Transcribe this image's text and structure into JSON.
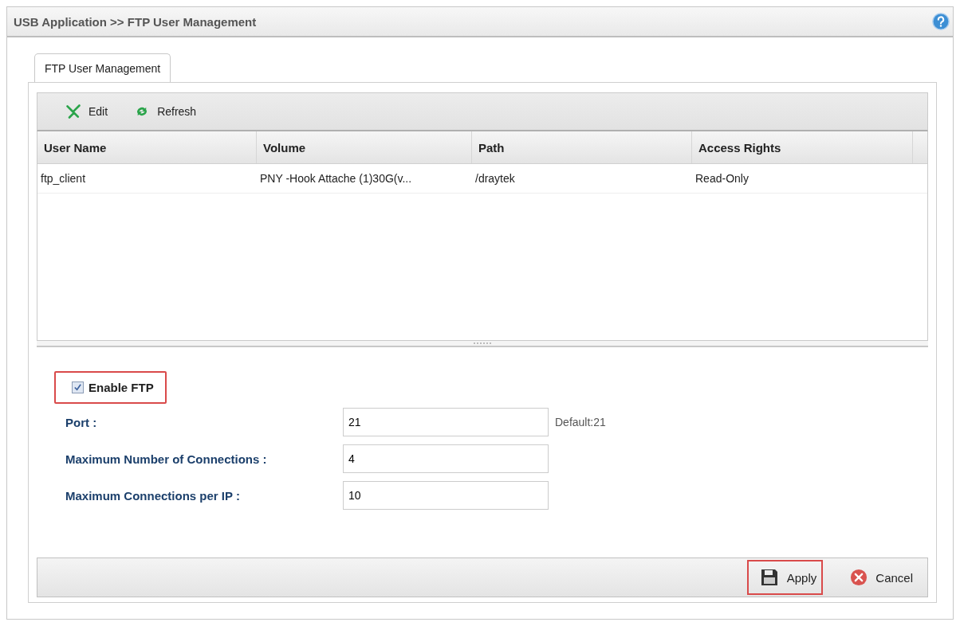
{
  "window": {
    "title": "USB Application >> FTP User Management"
  },
  "tabs": [
    {
      "label": "FTP User Management",
      "selected": true
    }
  ],
  "toolbar": [
    {
      "kind": "edit",
      "label": "Edit"
    },
    {
      "kind": "refresh",
      "label": "Refresh"
    }
  ],
  "table": {
    "columns": [
      "User Name",
      "Volume",
      "Path",
      "Access Rights"
    ],
    "rows": [
      [
        "ftp_client",
        "PNY -Hook Attache (1)30G(v...",
        "/draytek",
        "Read-Only"
      ]
    ]
  },
  "enable_ftp": {
    "label": "Enable FTP",
    "checked": true,
    "highlighted": true
  },
  "fields": [
    {
      "label": "Port :",
      "value": "21",
      "hint": "Default:21"
    },
    {
      "label": "Maximum Number of Connections :",
      "value": "4"
    },
    {
      "label": "Maximum Connections per IP :",
      "value": "10"
    }
  ],
  "buttons": [
    {
      "kind": "apply",
      "label": "Apply",
      "highlighted": true
    },
    {
      "kind": "cancel",
      "label": "Cancel",
      "highlighted": false
    }
  ]
}
